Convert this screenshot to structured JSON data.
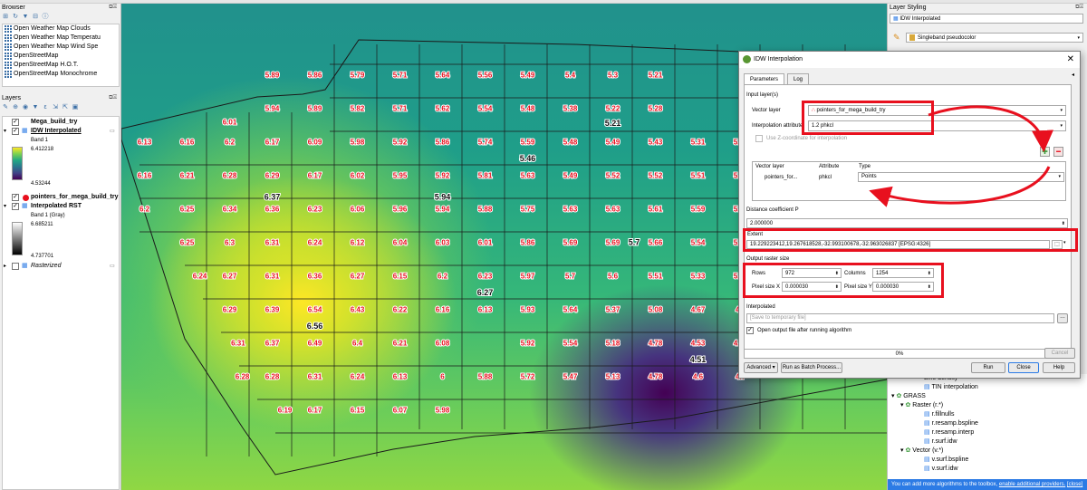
{
  "browser": {
    "title": "Browser",
    "items": [
      "Open Weather Map Clouds",
      "Open Weather Map Temperatu",
      "Open Weather Map Wind Spe",
      "OpenStreetMap",
      "OpenStreetMap H.O.T.",
      "OpenStreetMap Monochrome"
    ]
  },
  "layers": {
    "title": "Layers",
    "items": {
      "mega": "Mega_build_try",
      "idw": "IDW Interpolated",
      "idw_band": "Band 1",
      "idw_max": "6.412218",
      "idw_min": "4.53244",
      "points": "pointers_for_mega_build_try",
      "rst": "Interpolated RST",
      "rst_band": "Band 1 (Gray)",
      "rst_max": "6.685211",
      "rst_min": "4.737701",
      "rasterized": "Rasterized"
    }
  },
  "map": {
    "labels": [
      {
        "t": "5.89",
        "c": [
          3,
          1
        ]
      },
      {
        "t": "5.86",
        "c": [
          4,
          1
        ]
      },
      {
        "t": "5.79",
        "c": [
          5,
          1
        ]
      },
      {
        "t": "5.71",
        "c": [
          6,
          1
        ]
      },
      {
        "t": "5.64",
        "c": [
          7,
          1
        ]
      },
      {
        "t": "5.56",
        "c": [
          8,
          1
        ]
      },
      {
        "t": "5.49",
        "c": [
          9,
          1
        ]
      },
      {
        "t": "5.4",
        "c": [
          10,
          1
        ]
      },
      {
        "t": "5.3",
        "c": [
          11,
          1
        ]
      },
      {
        "t": "5.21",
        "c": [
          12,
          1
        ]
      },
      {
        "t": "5.94",
        "c": [
          3,
          2
        ]
      },
      {
        "t": "5.89",
        "c": [
          4,
          2
        ]
      },
      {
        "t": "5.82",
        "c": [
          5,
          2
        ]
      },
      {
        "t": "5.71",
        "c": [
          6,
          2
        ]
      },
      {
        "t": "5.62",
        "c": [
          7,
          2
        ]
      },
      {
        "t": "5.54",
        "c": [
          8,
          2
        ]
      },
      {
        "t": "5.48",
        "c": [
          9,
          2
        ]
      },
      {
        "t": "5.38",
        "c": [
          10,
          2
        ]
      },
      {
        "t": "5.22",
        "c": [
          11,
          2
        ]
      },
      {
        "t": "5.28",
        "c": [
          12,
          2
        ]
      },
      {
        "t": "6.01",
        "c": [
          2,
          2.4
        ]
      },
      {
        "t": "6.13",
        "c": [
          0,
          3
        ]
      },
      {
        "t": "6.16",
        "c": [
          1,
          3
        ]
      },
      {
        "t": "6.2",
        "c": [
          2,
          3
        ]
      },
      {
        "t": "6.17",
        "c": [
          3,
          3
        ]
      },
      {
        "t": "6.09",
        "c": [
          4,
          3
        ]
      },
      {
        "t": "5.98",
        "c": [
          5,
          3
        ]
      },
      {
        "t": "5.92",
        "c": [
          6,
          3
        ]
      },
      {
        "t": "5.86",
        "c": [
          7,
          3
        ]
      },
      {
        "t": "5.74",
        "c": [
          8,
          3
        ]
      },
      {
        "t": "5.59",
        "c": [
          9,
          3
        ]
      },
      {
        "t": "5.48",
        "c": [
          10,
          3
        ]
      },
      {
        "t": "5.49",
        "c": [
          11,
          3
        ]
      },
      {
        "t": "5.43",
        "c": [
          12,
          3
        ]
      },
      {
        "t": "5.31",
        "c": [
          13,
          3
        ]
      },
      {
        "t": "5.36",
        "c": [
          14,
          3
        ]
      },
      {
        "t": "6.16",
        "c": [
          0,
          4
        ]
      },
      {
        "t": "6.21",
        "c": [
          1,
          4
        ]
      },
      {
        "t": "6.28",
        "c": [
          2,
          4
        ]
      },
      {
        "t": "6.29",
        "c": [
          3,
          4
        ]
      },
      {
        "t": "6.17",
        "c": [
          4,
          4
        ]
      },
      {
        "t": "6.02",
        "c": [
          5,
          4
        ]
      },
      {
        "t": "5.95",
        "c": [
          6,
          4
        ]
      },
      {
        "t": "5.92",
        "c": [
          7,
          4
        ]
      },
      {
        "t": "5.81",
        "c": [
          8,
          4
        ]
      },
      {
        "t": "5.63",
        "c": [
          9,
          4
        ]
      },
      {
        "t": "5.49",
        "c": [
          10,
          4
        ]
      },
      {
        "t": "5.52",
        "c": [
          11,
          4
        ]
      },
      {
        "t": "5.52",
        "c": [
          12,
          4
        ]
      },
      {
        "t": "5.51",
        "c": [
          13,
          4
        ]
      },
      {
        "t": "5.59",
        "c": [
          14,
          4
        ]
      },
      {
        "t": "6.2",
        "c": [
          0,
          5
        ]
      },
      {
        "t": "6.25",
        "c": [
          1,
          5
        ]
      },
      {
        "t": "6.34",
        "c": [
          2,
          5
        ]
      },
      {
        "t": "6.36",
        "c": [
          3,
          5
        ]
      },
      {
        "t": "6.23",
        "c": [
          4,
          5
        ]
      },
      {
        "t": "6.06",
        "c": [
          5,
          5
        ]
      },
      {
        "t": "5.96",
        "c": [
          6,
          5
        ]
      },
      {
        "t": "5.94",
        "c": [
          7,
          5
        ]
      },
      {
        "t": "5.88",
        "c": [
          8,
          5
        ]
      },
      {
        "t": "5.75",
        "c": [
          9,
          5
        ]
      },
      {
        "t": "5.63",
        "c": [
          10,
          5
        ]
      },
      {
        "t": "5.63",
        "c": [
          11,
          5
        ]
      },
      {
        "t": "5.61",
        "c": [
          12,
          5
        ]
      },
      {
        "t": "5.59",
        "c": [
          13,
          5
        ]
      },
      {
        "t": "5.77",
        "c": [
          14,
          5
        ]
      },
      {
        "t": "6.25",
        "c": [
          1,
          6
        ]
      },
      {
        "t": "6.3",
        "c": [
          2,
          6
        ]
      },
      {
        "t": "6.31",
        "c": [
          3,
          6
        ]
      },
      {
        "t": "6.24",
        "c": [
          4,
          6
        ]
      },
      {
        "t": "6.12",
        "c": [
          5,
          6
        ]
      },
      {
        "t": "6.04",
        "c": [
          6,
          6
        ]
      },
      {
        "t": "6.03",
        "c": [
          7,
          6
        ]
      },
      {
        "t": "6.01",
        "c": [
          8,
          6
        ]
      },
      {
        "t": "5.86",
        "c": [
          9,
          6
        ]
      },
      {
        "t": "5.69",
        "c": [
          10,
          6
        ]
      },
      {
        "t": "5.69",
        "c": [
          11,
          6
        ]
      },
      {
        "t": "5.66",
        "c": [
          12,
          6
        ]
      },
      {
        "t": "5.54",
        "c": [
          13,
          6
        ]
      },
      {
        "t": "5.63",
        "c": [
          14,
          6
        ]
      },
      {
        "t": "6.24",
        "c": [
          1.3,
          7
        ]
      },
      {
        "t": "6.27",
        "c": [
          2,
          7
        ]
      },
      {
        "t": "6.31",
        "c": [
          3,
          7
        ]
      },
      {
        "t": "6.36",
        "c": [
          4,
          7
        ]
      },
      {
        "t": "6.27",
        "c": [
          5,
          7
        ]
      },
      {
        "t": "6.15",
        "c": [
          6,
          7
        ]
      },
      {
        "t": "6.2",
        "c": [
          7,
          7
        ]
      },
      {
        "t": "6.23",
        "c": [
          8,
          7
        ]
      },
      {
        "t": "5.97",
        "c": [
          9,
          7
        ]
      },
      {
        "t": "5.7",
        "c": [
          10,
          7
        ]
      },
      {
        "t": "5.6",
        "c": [
          11,
          7
        ]
      },
      {
        "t": "5.51",
        "c": [
          12,
          7
        ]
      },
      {
        "t": "5.33",
        "c": [
          13,
          7
        ]
      },
      {
        "t": "5.24",
        "c": [
          14,
          7
        ]
      },
      {
        "t": "6.29",
        "c": [
          2,
          8
        ]
      },
      {
        "t": "6.39",
        "c": [
          3,
          8
        ]
      },
      {
        "t": "6.54",
        "c": [
          4,
          8
        ]
      },
      {
        "t": "6.43",
        "c": [
          5,
          8
        ]
      },
      {
        "t": "6.22",
        "c": [
          6,
          8
        ]
      },
      {
        "t": "6.16",
        "c": [
          7,
          8
        ]
      },
      {
        "t": "6.13",
        "c": [
          8,
          8
        ]
      },
      {
        "t": "5.93",
        "c": [
          9,
          8
        ]
      },
      {
        "t": "5.64",
        "c": [
          10,
          8
        ]
      },
      {
        "t": "5.37",
        "c": [
          11,
          8
        ]
      },
      {
        "t": "5.08",
        "c": [
          12,
          8
        ]
      },
      {
        "t": "4.67",
        "c": [
          13,
          8
        ]
      },
      {
        "t": "4.9",
        "c": [
          14,
          8
        ]
      },
      {
        "t": "6.31",
        "c": [
          2.2,
          9
        ]
      },
      {
        "t": "6.37",
        "c": [
          3,
          9
        ]
      },
      {
        "t": "6.49",
        "c": [
          4,
          9
        ]
      },
      {
        "t": "6.4",
        "c": [
          5,
          9
        ]
      },
      {
        "t": "6.21",
        "c": [
          6,
          9
        ]
      },
      {
        "t": "6.08",
        "c": [
          7,
          9
        ]
      },
      {
        "t": "5.92",
        "c": [
          9,
          9
        ]
      },
      {
        "t": "5.54",
        "c": [
          10,
          9
        ]
      },
      {
        "t": "5.18",
        "c": [
          11,
          9
        ]
      },
      {
        "t": "4.78",
        "c": [
          12,
          9
        ]
      },
      {
        "t": "4.53",
        "c": [
          13,
          9
        ]
      },
      {
        "t": "4.75",
        "c": [
          14,
          9
        ]
      },
      {
        "t": "6.28",
        "c": [
          2.3,
          10
        ]
      },
      {
        "t": "6.28",
        "c": [
          3,
          10
        ]
      },
      {
        "t": "6.31",
        "c": [
          4,
          10
        ]
      },
      {
        "t": "6.24",
        "c": [
          5,
          10
        ]
      },
      {
        "t": "6.13",
        "c": [
          6,
          10
        ]
      },
      {
        "t": "6",
        "c": [
          7,
          10
        ]
      },
      {
        "t": "5.88",
        "c": [
          8,
          10
        ]
      },
      {
        "t": "5.72",
        "c": [
          9,
          10
        ]
      },
      {
        "t": "5.47",
        "c": [
          10,
          10
        ]
      },
      {
        "t": "5.13",
        "c": [
          11,
          10
        ]
      },
      {
        "t": "4.78",
        "c": [
          12,
          10
        ]
      },
      {
        "t": "4.6",
        "c": [
          13,
          10
        ]
      },
      {
        "t": "4.7",
        "c": [
          14,
          10
        ]
      },
      {
        "t": "6.19",
        "c": [
          3.3,
          11
        ]
      },
      {
        "t": "6.17",
        "c": [
          4,
          11
        ]
      },
      {
        "t": "6.15",
        "c": [
          5,
          11
        ]
      },
      {
        "t": "6.07",
        "c": [
          6,
          11
        ]
      },
      {
        "t": "5.98",
        "c": [
          7,
          11
        ]
      }
    ],
    "black_labels": [
      {
        "t": "5.21",
        "c": [
          11,
          2.45
        ]
      },
      {
        "t": "5.46",
        "c": [
          9,
          3.5
        ]
      },
      {
        "t": "6.37",
        "c": [
          3,
          4.65
        ]
      },
      {
        "t": "5.94",
        "c": [
          7,
          4.65
        ]
      },
      {
        "t": "5.7",
        "c": [
          11.5,
          6
        ]
      },
      {
        "t": "6.27",
        "c": [
          8,
          7.5
        ]
      },
      {
        "t": "6.56",
        "c": [
          4,
          8.5
        ]
      },
      {
        "t": "4.51",
        "c": [
          13,
          9.5
        ]
      }
    ],
    "colors": {
      "label_fill": "#e8101e",
      "label_outline": "#ffffff",
      "grid": "#1a1a1a"
    }
  },
  "styling": {
    "title": "Layer Styling",
    "layer": "IDW Interpolated",
    "renderer": "Singleband pseudocolor"
  },
  "toolbox": {
    "items": {
      "line_density": "Line density",
      "tin": "TIN interpolation",
      "grass": "GRASS",
      "raster": "Raster (r.*)",
      "r_fillnulls": "r.fillnulls",
      "r_bspline": "r.resamp.bspline",
      "r_interp": "r.resamp.interp",
      "r_idw": "r.surf.idw",
      "vector": "Vector (v.*)",
      "v_bspline": "v.surf.bspline",
      "v_idw": "v.surf.idw"
    },
    "status": "You can add more algorithms to the toolbox,",
    "status_link": "enable additional providers.",
    "status_tail": "[close]"
  },
  "dialog": {
    "title": "IDW Interpolation",
    "tab_params": "Parameters",
    "tab_log": "Log",
    "input_layers": "Input layer(s)",
    "vector_layer_label": "Vector layer",
    "vector_layer": "pointers_for_mega_build_try",
    "interp_attr_label": "Interpolation attribute",
    "interp_attr": "1.2 phkcl",
    "use_z": "Use Z-coordinate for interpolation",
    "col_vector": "Vector layer",
    "col_attr": "Attribute",
    "col_type": "Type",
    "row_vector": "pointers_for...",
    "row_attr": "phkcl",
    "row_type": "Points",
    "dist_label": "Distance coefficient P",
    "dist": "2.000000",
    "extent_label": "Extent",
    "extent": "19.229223412,19.267618528,-32.993100678,-32.963026837 [EPSG:4326]",
    "raster_size": "Output raster size",
    "rows_label": "Rows",
    "rows": "972",
    "cols_label": "Columns",
    "cols": "1254",
    "psx_label": "Pixel size X",
    "psx": "0.000030",
    "psy_label": "Pixel size Y",
    "psy": "0.000030",
    "interpolated_label": "Interpolated",
    "interpolated_placeholder": "[Save to temporary file]",
    "open_output": "Open output file after running algorithm",
    "progress": "0%",
    "cancel": "Cancel",
    "advanced": "Advanced",
    "batch": "Run as Batch Process...",
    "run": "Run",
    "close": "Close",
    "help": "Help"
  }
}
